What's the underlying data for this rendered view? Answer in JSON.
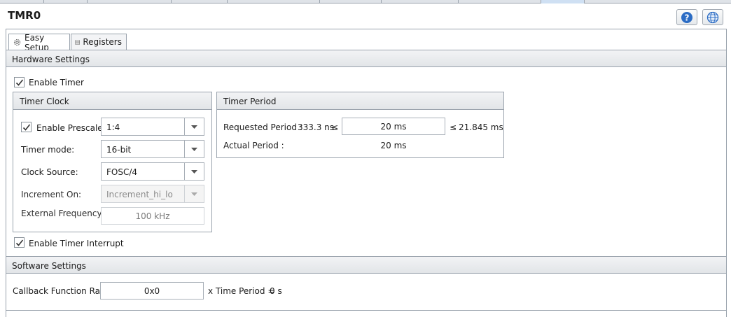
{
  "title": "TMR0",
  "header_icons": {
    "help": "help-icon",
    "globe": "globe-icon"
  },
  "tabs": [
    {
      "label": "Easy Setup",
      "icon": "gear-icon",
      "active": true
    },
    {
      "label": "Registers",
      "icon": "registers-icon",
      "active": false
    }
  ],
  "hardware": {
    "section_title": "Hardware Settings",
    "enable_timer": {
      "label": "Enable Timer",
      "checked": true
    },
    "timer_clock": {
      "title": "Timer Clock",
      "enable_prescaler": {
        "label": "Enable Prescaler",
        "checked": true,
        "value": "1:4"
      },
      "timer_mode": {
        "label": "Timer mode:",
        "value": "16-bit"
      },
      "clock_source": {
        "label": "Clock Source:",
        "value": "FOSC/4"
      },
      "increment_on": {
        "label": "Increment On:",
        "value": "Increment_hi_lo",
        "disabled": true
      },
      "external_frequency": {
        "label": "External Frequency :",
        "value": "100 kHz",
        "disabled": true
      }
    },
    "timer_period": {
      "title": "Timer Period",
      "requested_label": "Requested Period :",
      "min": "333.3 ns",
      "le1": "≤",
      "requested_value": "20 ms",
      "le2": "≤",
      "max": "21.845 ms",
      "actual_label": "Actual Period :",
      "actual_value": "20 ms"
    },
    "enable_interrupt": {
      "label": "Enable Timer Interrupt",
      "checked": true
    }
  },
  "software": {
    "section_title": "Software Settings",
    "callback_label": "Callback Function Rate",
    "callback_value": "0x0",
    "x_time_period_label": "x Time Period =",
    "time_period_value": "0 s"
  },
  "colors": {
    "accent_blue": "#2b6cc4",
    "border": "#9aa3ad",
    "header_bg": "#e2e5e8"
  }
}
